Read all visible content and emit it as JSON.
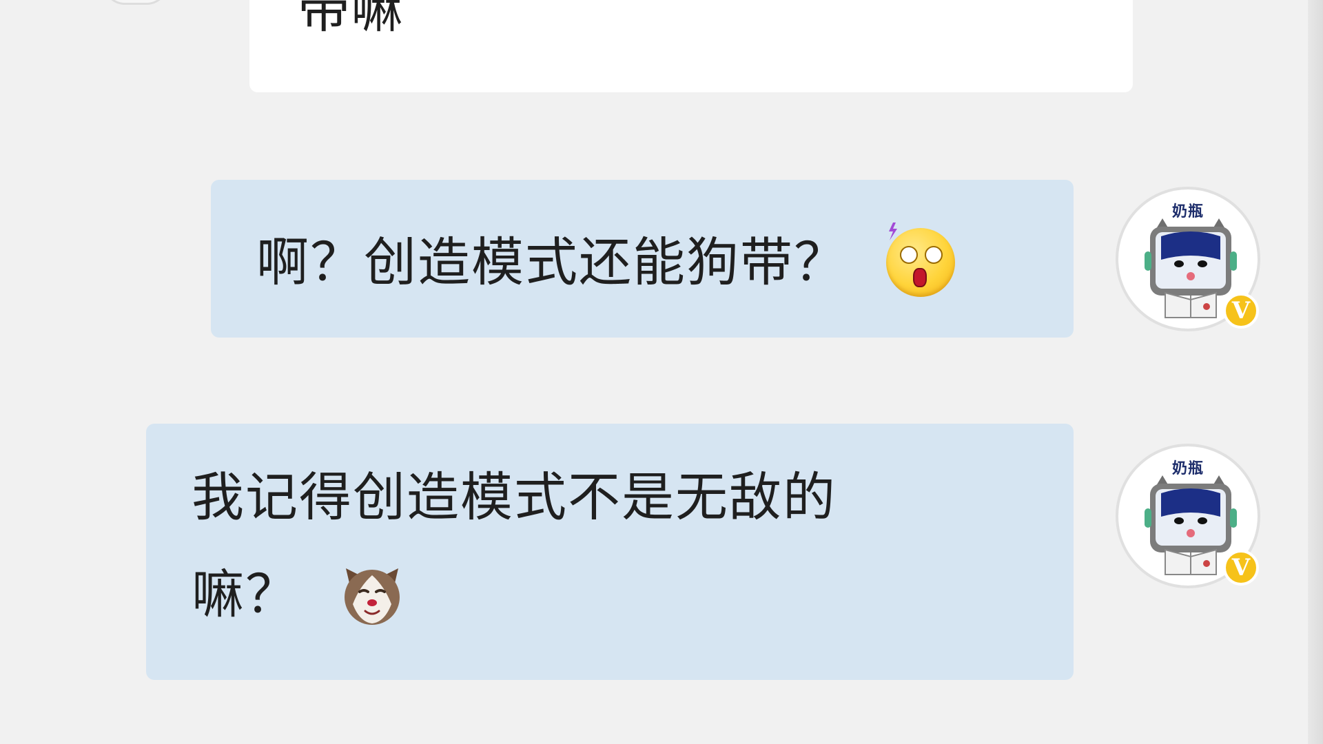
{
  "chat": {
    "incoming_partial": {
      "text": "带嘛"
    },
    "messages": [
      {
        "lines": [
          "啊？创造模式还能狗带？"
        ],
        "emoji": "shocked-face-icon",
        "sender": {
          "avatar_label": "奶瓶",
          "badge": "V"
        }
      },
      {
        "lines": [
          "我记得创造模式不是无敌的",
          "嘛？"
        ],
        "emoji": "husky-dog-icon",
        "sender": {
          "avatar_label": "奶瓶",
          "badge": "V"
        }
      }
    ]
  },
  "colors": {
    "background": "#f1f1f1",
    "incoming_bubble": "#ffffff",
    "outgoing_bubble": "#d6e5f2",
    "badge": "#f6c21a"
  }
}
